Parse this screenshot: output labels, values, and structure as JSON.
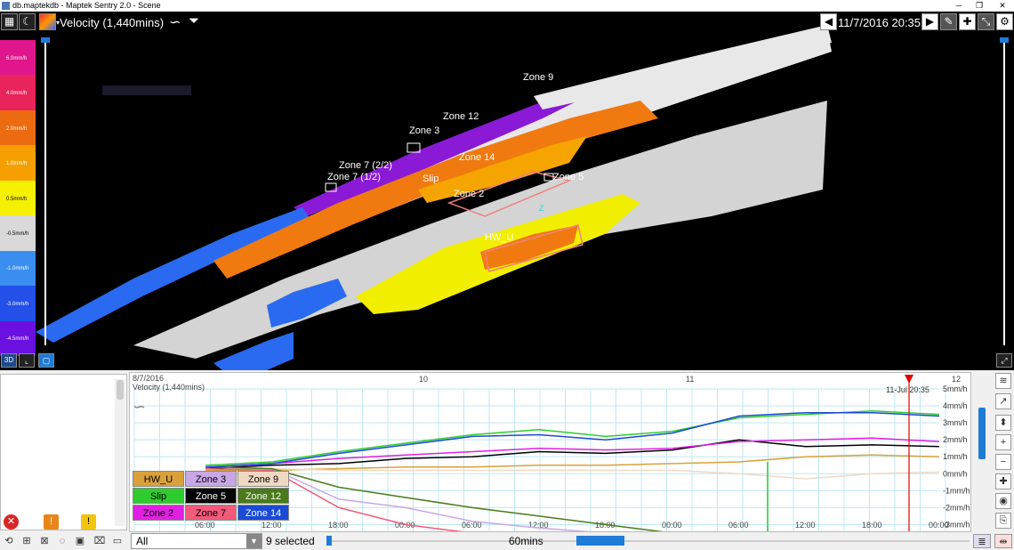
{
  "window": {
    "title": "db.maptekdb - Maptek Sentry 2.0 - Scene"
  },
  "scene": {
    "variable_title": "Velocity (1,440mins)",
    "datetime": "11/7/2016 20:35",
    "legend": [
      {
        "label": "6.0mm/h",
        "color": "#e0168c"
      },
      {
        "label": "4.0mm/h",
        "color": "#e8245a"
      },
      {
        "label": "2.0mm/h",
        "color": "#ec6a10"
      },
      {
        "label": "1.0mm/h",
        "color": "#f5a000"
      },
      {
        "label": "0.5mm/h",
        "color": "#f5f000"
      },
      {
        "label": "-0.5mm/h",
        "color": "#d9d9d9"
      },
      {
        "label": "-1.0mm/h",
        "color": "#3a8ef0"
      },
      {
        "label": "-3.0mm/h",
        "color": "#2250e8"
      },
      {
        "label": "-4.5mm/h",
        "color": "#6a10e0"
      }
    ],
    "zones": [
      "Zone 9",
      "Zone 12",
      "Zone 3",
      "Zone 14",
      "Zone 7 (2/2)",
      "Zone 7 (1/2)",
      "Slip",
      "Zone 5",
      "Zone 2",
      "HW_U"
    ],
    "axis_z": "Z"
  },
  "chart": {
    "start_date": "8/7/2016",
    "variable": "Velocity (1,440mins)",
    "cursor_label": "11-Jul 20:35",
    "day_labels": [
      "10",
      "11",
      "12"
    ],
    "hour_labels": [
      "18:00",
      "00:00",
      "06:00",
      "12:00",
      "18:00",
      "00:00",
      "06:00",
      "12:00",
      "18:00",
      "00:00",
      "06:00",
      "12:00",
      "18:00",
      "00:00"
    ],
    "left_hour_labels": [
      "06:00",
      "12:00"
    ],
    "y_labels": [
      "5mm/h",
      "4mm/h",
      "3mm/h",
      "2mm/h",
      "1mm/h",
      "0mm/h",
      "-1mm/h",
      "-2mm/h",
      "-3mm/h"
    ]
  },
  "zone_buttons": [
    {
      "label": "HW_U",
      "bg": "#d9a13a",
      "fg": "#000"
    },
    {
      "label": "Zone 3",
      "bg": "#c9a6e6",
      "fg": "#000"
    },
    {
      "label": "Zone 9",
      "bg": "#f0d9c4",
      "fg": "#000"
    },
    {
      "label": "Slip",
      "bg": "#2ecc2e",
      "fg": "#000"
    },
    {
      "label": "Zone 5",
      "bg": "#000000",
      "fg": "#fff"
    },
    {
      "label": "Zone 12",
      "bg": "#4a7a1a",
      "fg": "#fff"
    },
    {
      "label": "Zone 2",
      "bg": "#e020e0",
      "fg": "#000"
    },
    {
      "label": "Zone 7",
      "bg": "#f25a7a",
      "fg": "#000"
    },
    {
      "label": "Zone 14",
      "bg": "#1a4ad6",
      "fg": "#fff"
    }
  ],
  "status": {
    "errors": "0",
    "warnings_orange": "0",
    "warnings_yellow": "0"
  },
  "bottombar": {
    "filter_value": "All",
    "selected_count": "9 selected",
    "interval": "60mins"
  },
  "chart_data": {
    "type": "line",
    "title": "Velocity (1,440mins)",
    "xlabel": "",
    "ylabel": "",
    "ylim": [
      -3.5,
      5
    ],
    "x": [
      "9/7 06:00",
      "9/7 12:00",
      "9/7 18:00",
      "10/7 00:00",
      "10/7 06:00",
      "10/7 12:00",
      "10/7 18:00",
      "11/7 00:00",
      "11/7 06:00",
      "11/7 12:00",
      "11/7 18:00",
      "12/7 00:00"
    ],
    "series": [
      {
        "name": "HW_U",
        "color": "#d9a13a",
        "values": [
          0.2,
          0.2,
          0.3,
          0.4,
          0.4,
          0.5,
          0.5,
          0.6,
          0.7,
          1.0,
          1.1,
          1.0
        ]
      },
      {
        "name": "Zone 3",
        "color": "#c9a6e6",
        "values": [
          0.4,
          0.3,
          -1.5,
          -2.0,
          -2.8,
          -3.2,
          -3.5,
          -3.5,
          -3.5,
          -3.5,
          -3.5,
          -3.5
        ]
      },
      {
        "name": "Zone 9",
        "color": "#f0d9c4",
        "values": [
          0.3,
          0.3,
          0.2,
          0.2,
          0.2,
          0.2,
          0.2,
          0.2,
          0.0,
          -0.3,
          0.0,
          0.1
        ]
      },
      {
        "name": "Slip",
        "color": "#2ecc2e",
        "values": [
          0.5,
          0.7,
          1.3,
          1.8,
          2.3,
          2.6,
          2.2,
          2.5,
          3.3,
          3.5,
          3.7,
          3.5
        ]
      },
      {
        "name": "Zone 5",
        "color": "#000000",
        "values": [
          0.3,
          0.5,
          0.6,
          0.9,
          1.0,
          1.3,
          1.2,
          1.4,
          2.0,
          1.6,
          1.7,
          1.6
        ]
      },
      {
        "name": "Zone 12",
        "color": "#4a7a1a",
        "values": [
          0.4,
          0.3,
          -0.8,
          -1.4,
          -2.0,
          -2.5,
          -3.0,
          -3.5,
          -3.5,
          -3.5,
          -3.5,
          -3.5
        ]
      },
      {
        "name": "Zone 2",
        "color": "#e020e0",
        "values": [
          0.4,
          0.6,
          0.9,
          1.1,
          1.3,
          1.5,
          1.4,
          1.5,
          1.9,
          2.0,
          2.1,
          1.9
        ]
      },
      {
        "name": "Zone 7",
        "color": "#f25a7a",
        "values": [
          0.3,
          0.2,
          -2.0,
          -3.0,
          -3.5,
          -3.5,
          -3.5,
          -3.5,
          -3.5,
          -3.5,
          -3.5,
          -3.5
        ]
      },
      {
        "name": "Zone 14",
        "color": "#1a4ad6",
        "values": [
          0.4,
          0.6,
          1.2,
          1.7,
          2.2,
          2.3,
          2.0,
          2.4,
          3.4,
          3.6,
          3.6,
          3.4
        ]
      }
    ]
  }
}
